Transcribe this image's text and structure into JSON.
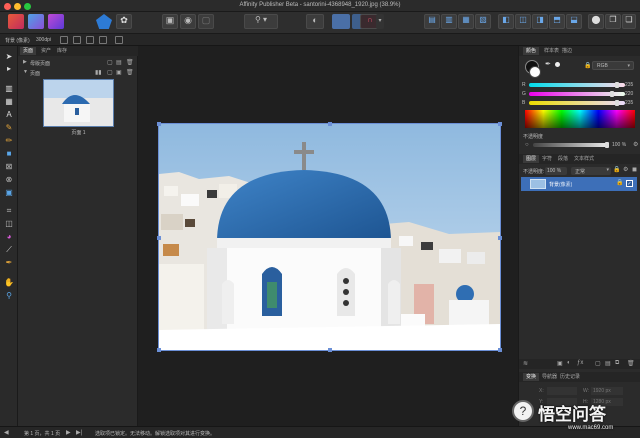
{
  "window": {
    "title": "Affinity Publisher Beta - santorini-4368948_1920.jpg (38.9%)"
  },
  "context_bar": {
    "doc_label": "背景 (像素)",
    "dpi": "300dpi"
  },
  "pages_panel": {
    "tabs": [
      "页面",
      "资产",
      "库存"
    ],
    "master_section": "母版页面",
    "pages_section": "页面",
    "page_label": "页面 1"
  },
  "color_panel": {
    "tabs": [
      "颜色",
      "样本表",
      "描边"
    ],
    "mode": "RGB",
    "channels": [
      {
        "name": "R",
        "value": "235"
      },
      {
        "name": "G",
        "value": "220"
      },
      {
        "name": "B",
        "value": "235"
      }
    ],
    "opacity_label": "不透明度",
    "opacity_value": "100 %"
  },
  "layers_panel": {
    "tabs": [
      "图层",
      "字符",
      "段落",
      "文本样式"
    ],
    "opacity_label": "不透明度:",
    "opacity_value": "100 %",
    "blend_mode": "正常",
    "layer_name": "背景",
    "layer_type": "(像素)"
  },
  "transform_panel": {
    "tabs": [
      "变换",
      "导航器",
      "历史记录"
    ],
    "x_label": "X:",
    "y_label": "Y:",
    "w_label": "W:",
    "h_label": "H:",
    "w_value": "1920 px",
    "h_value": "1280 px"
  },
  "status_bar": {
    "page_indicator": "第 1 页，共 1 页",
    "hint": "选取项已锁定。无法移动。解锁选取项对其进行变换。"
  },
  "watermark": {
    "text": "悟空问答",
    "url": "www.mac69.com"
  }
}
